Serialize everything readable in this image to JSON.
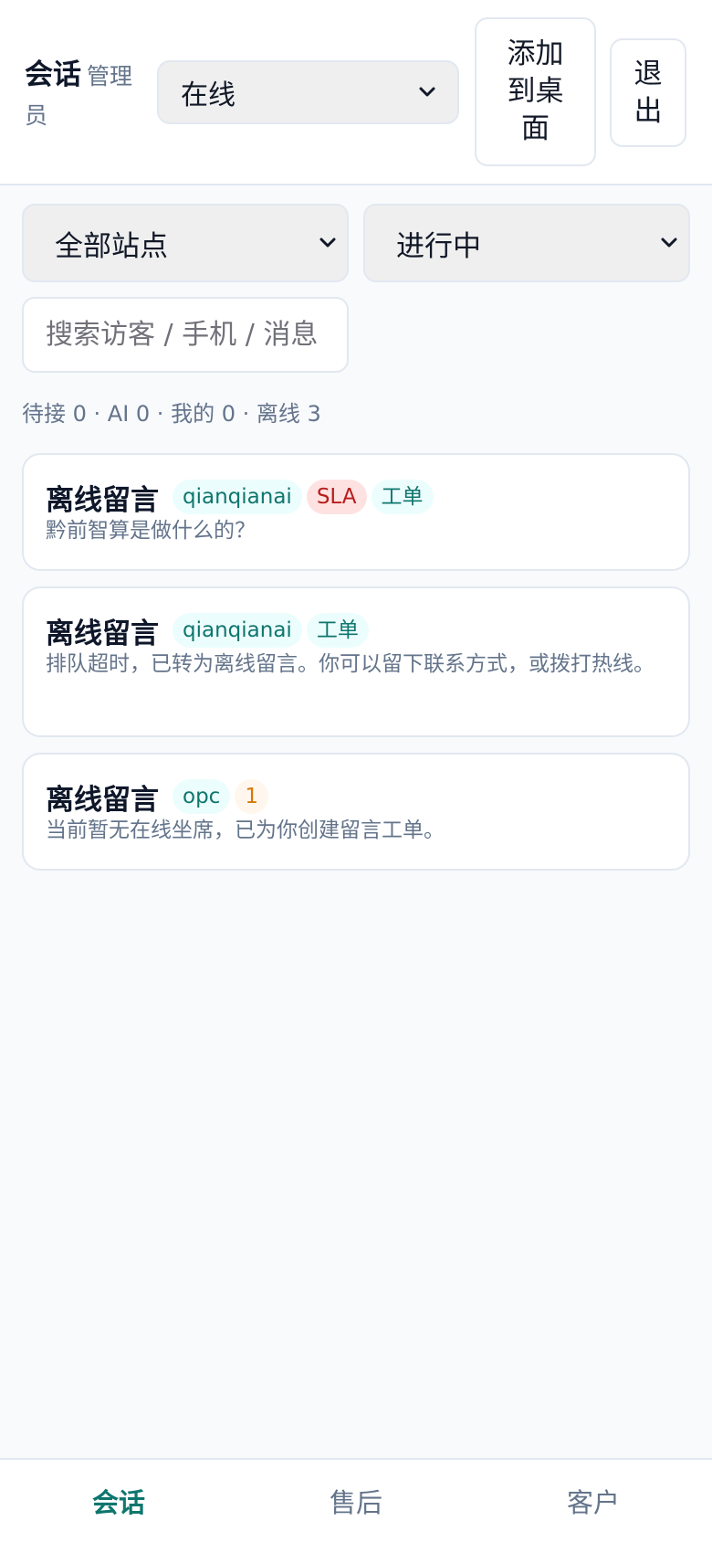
{
  "header": {
    "title": "会话",
    "role": "管理员",
    "status_select": {
      "value": "在线"
    },
    "install_button": "添加到桌面",
    "logout_button": "退出"
  },
  "filters": {
    "site": {
      "value": "全部站点"
    },
    "state": {
      "value": "进行中"
    },
    "search": {
      "placeholder": "搜索访客 / 手机 / 消息"
    }
  },
  "counts_text": "待接 0 · AI 0 · 我的 0 · 离线 3",
  "conversations": [
    {
      "title": "离线留言",
      "site_tag": "qianqianai",
      "sla_tag": "SLA",
      "ticket_tag": "工单",
      "preview": "黔前智算是做什么的？"
    },
    {
      "title": "离线留言",
      "site_tag": "qianqianai",
      "ticket_tag": "工单",
      "preview": "排队超时，已转为离线留言。你可以留下联系方式，或拨打热线。"
    },
    {
      "title": "离线留言",
      "site_tag": "opc",
      "unread_tag": "1",
      "preview": "当前暂无在线坐席，已为你创建留言工单。"
    }
  ],
  "tabbar": {
    "tabs": [
      {
        "label": "会话",
        "active": true
      },
      {
        "label": "售后",
        "active": false
      },
      {
        "label": "客户",
        "active": false
      }
    ]
  },
  "colors": {
    "accent": "#0f766e",
    "sla": "#b91c1c",
    "unread": "#d97706",
    "muted": "#64748b",
    "background": "#f8fafc"
  },
  "icons": [
    "chevron-down-icon"
  ]
}
